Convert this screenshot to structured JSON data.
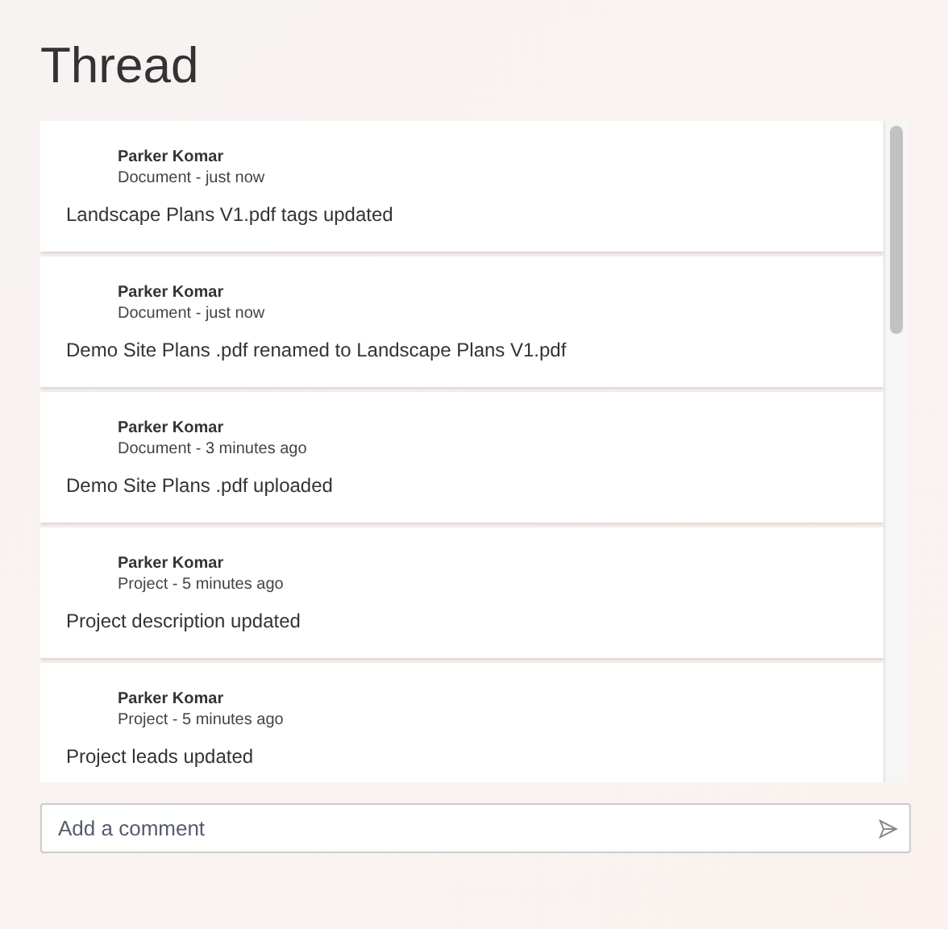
{
  "title": "Thread",
  "entries": [
    {
      "author": "Parker Komar",
      "meta": "Document - just now",
      "message": "Landscape Plans V1.pdf tags updated"
    },
    {
      "author": "Parker Komar",
      "meta": "Document - just now",
      "message": "Demo Site Plans .pdf renamed to Landscape Plans V1.pdf"
    },
    {
      "author": "Parker Komar",
      "meta": "Document - 3 minutes ago",
      "message": "Demo Site Plans .pdf uploaded"
    },
    {
      "author": "Parker Komar",
      "meta": "Project - 5 minutes ago",
      "message": "Project description updated"
    },
    {
      "author": "Parker Komar",
      "meta": "Project - 5 minutes ago",
      "message": "Project leads updated"
    }
  ],
  "comment": {
    "placeholder": "Add a comment"
  }
}
